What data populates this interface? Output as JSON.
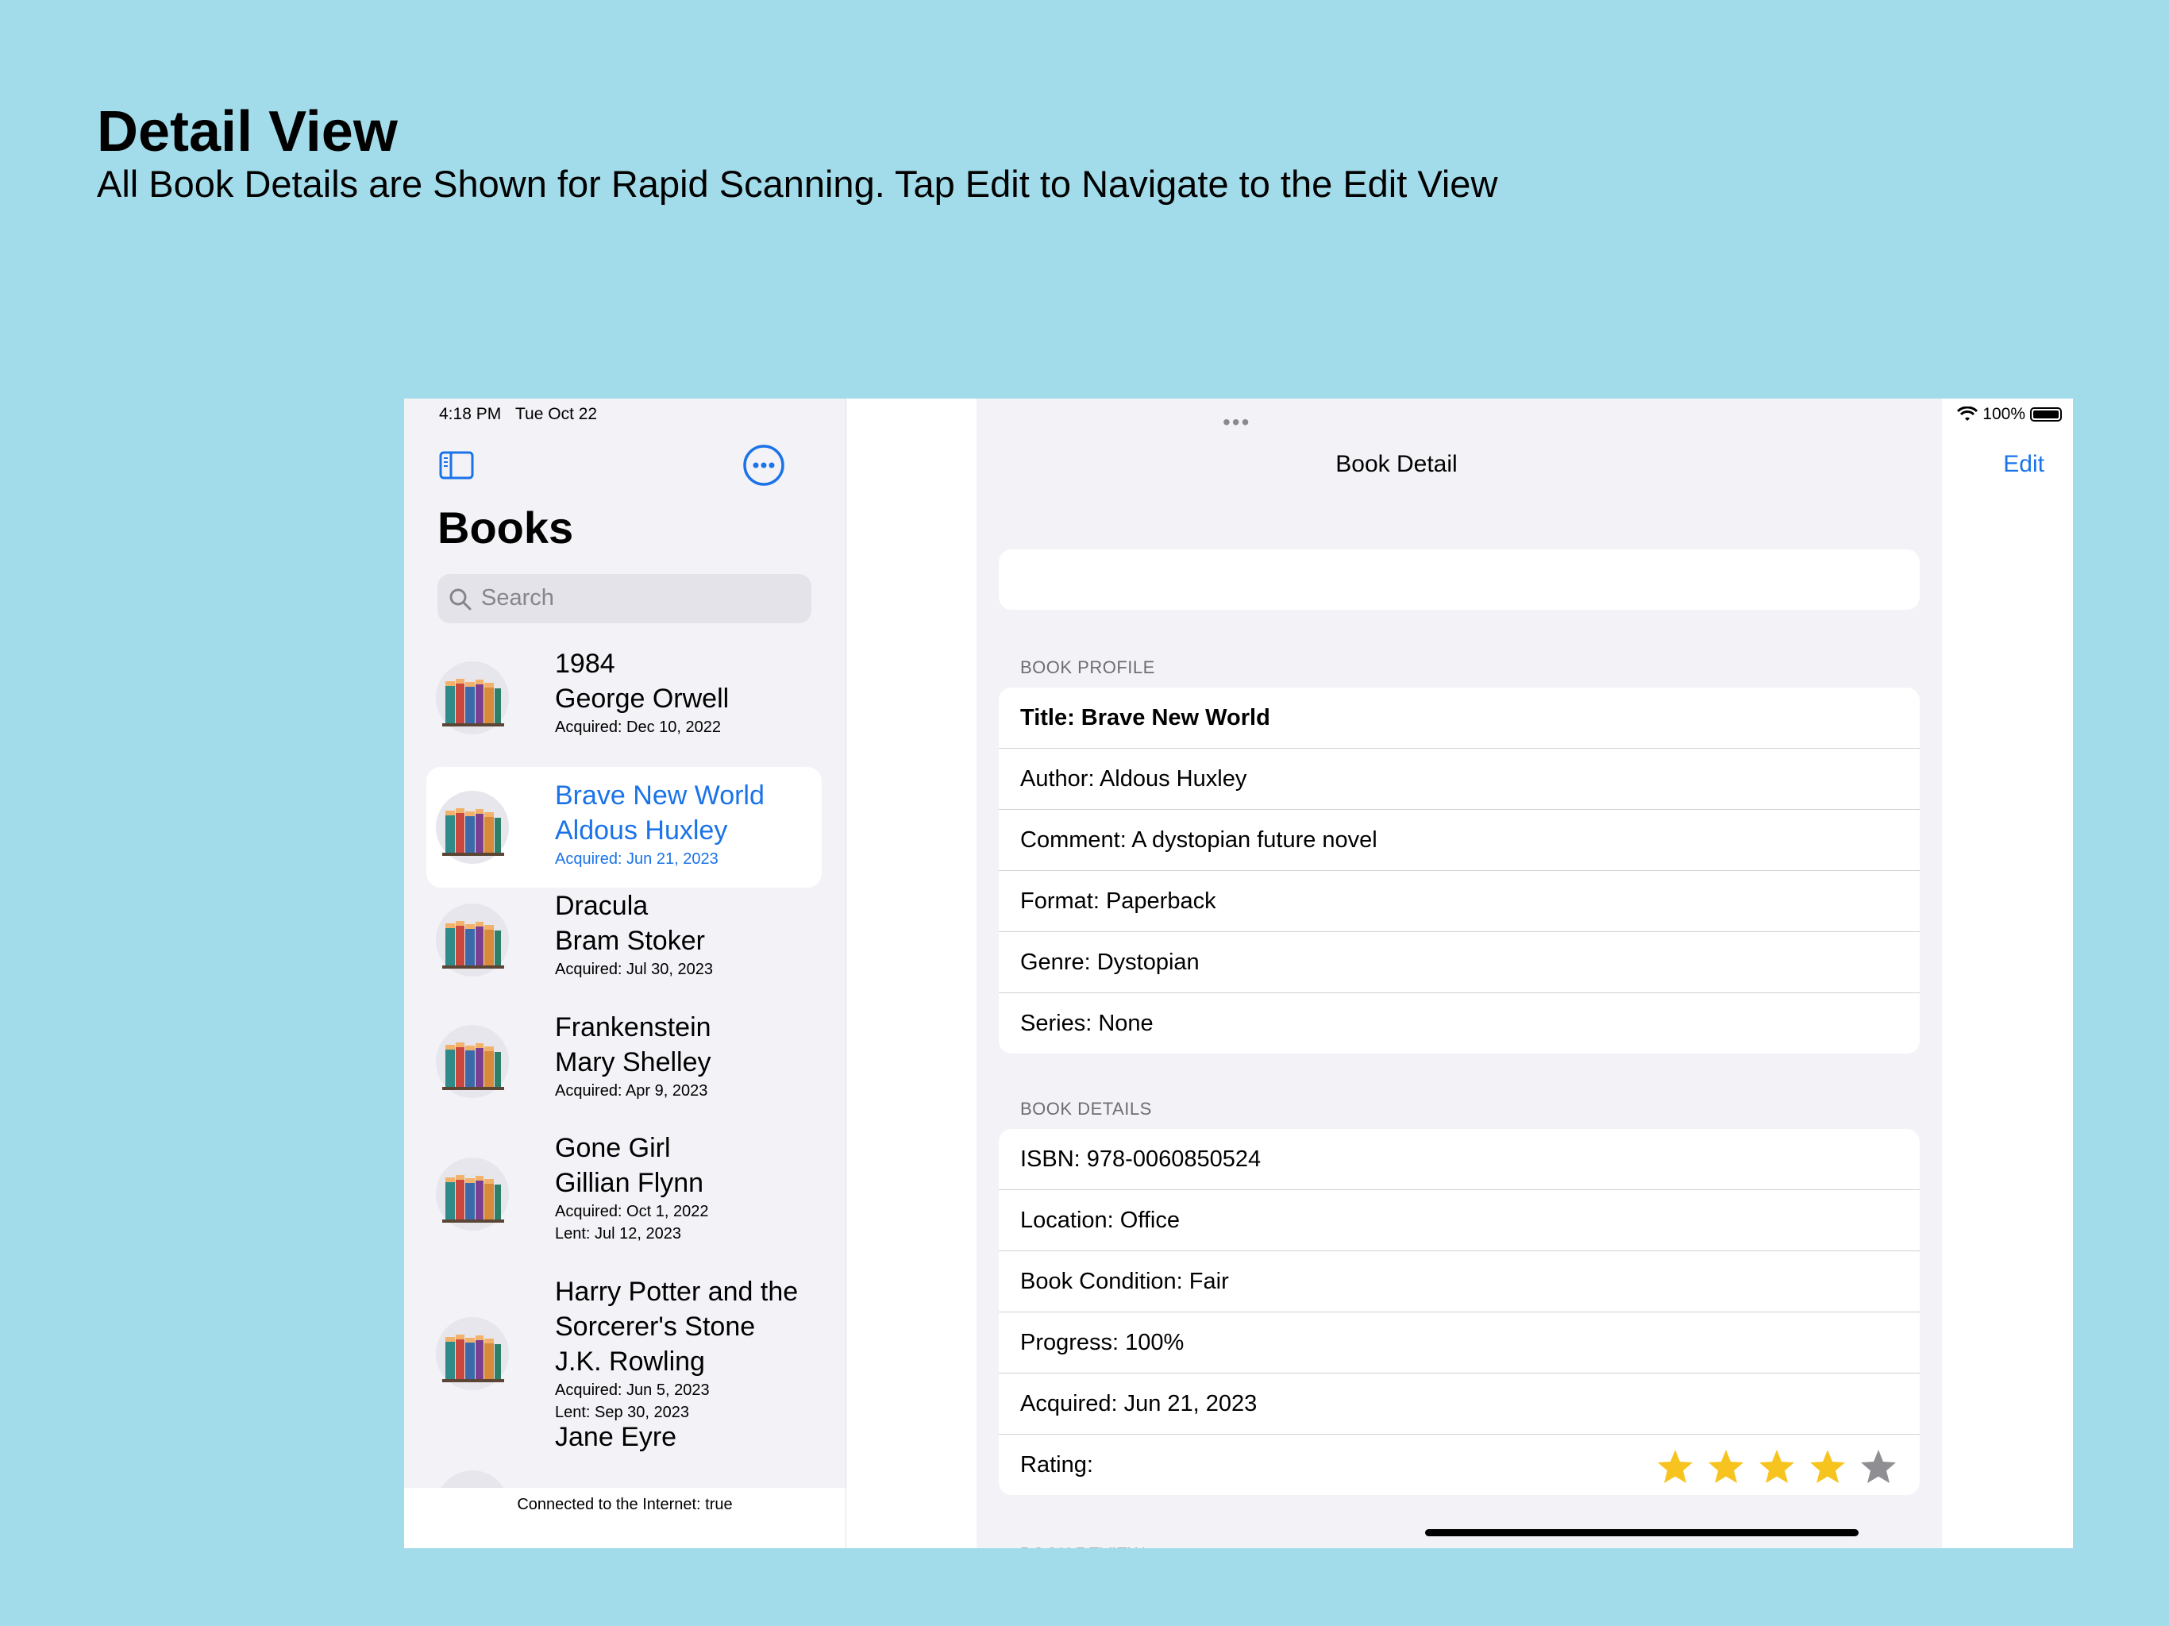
{
  "heading": {
    "title": "Detail View",
    "subtitle": "All Book Details are Shown for Rapid Scanning. Tap Edit to Navigate to the Edit View"
  },
  "status_bar": {
    "time": "4:18 PM",
    "date": "Tue Oct 22",
    "battery": "100%"
  },
  "sidebar": {
    "title": "Books",
    "search_placeholder": "Search",
    "footer": "Connected to the Internet: true",
    "items": [
      {
        "title": "1984",
        "author": "George Orwell",
        "acquired": "Acquired: Dec 10, 2022",
        "lent": "",
        "selected": false
      },
      {
        "title": "Brave New World",
        "author": "Aldous Huxley",
        "acquired": "Acquired: Jun 21, 2023",
        "lent": "",
        "selected": true
      },
      {
        "title": "Dracula",
        "author": "Bram Stoker",
        "acquired": "Acquired: Jul 30, 2023",
        "lent": "",
        "selected": false
      },
      {
        "title": "Frankenstein",
        "author": "Mary Shelley",
        "acquired": "Acquired: Apr 9, 2023",
        "lent": "",
        "selected": false
      },
      {
        "title": "Gone Girl",
        "author": "Gillian Flynn",
        "acquired": "Acquired: Oct 1, 2022",
        "lent": "Lent: Jul 12, 2023",
        "selected": false
      },
      {
        "title": "Harry Potter and the Sorcerer's Stone",
        "author": "J.K. Rowling",
        "acquired": "Acquired: Jun 5, 2023",
        "lent": "Lent: Sep 30, 2023",
        "selected": false
      },
      {
        "title": "Jane Eyre",
        "author": "",
        "acquired": "",
        "lent": "",
        "selected": false
      }
    ]
  },
  "detail": {
    "nav_title": "Book Detail",
    "edit_label": "Edit",
    "profile_header": "BOOK PROFILE",
    "profile_rows": [
      "Title: Brave New World",
      "Author: Aldous Huxley",
      "Comment: A dystopian future novel",
      "Format: Paperback",
      "Genre: Dystopian",
      "Series: None"
    ],
    "details_header": "BOOK DETAILS",
    "details_rows": [
      "ISBN: 978-0060850524",
      "Location: Office",
      "Book Condition: Fair",
      "Progress: 100%",
      "Acquired: Jun 21, 2023"
    ],
    "rating_label": "Rating:",
    "rating_value": 4,
    "rating_max": 5,
    "next_section_header": "BOOK REVIEW"
  },
  "colors": {
    "accent": "#1a73e8",
    "star_filled": "#f7c41f",
    "star_empty": "#8e8e93"
  },
  "icons": [
    "sidebar-toggle-icon",
    "more-icon",
    "search-icon",
    "wifi-icon",
    "battery-icon",
    "book-stack-icon",
    "star-icon"
  ]
}
